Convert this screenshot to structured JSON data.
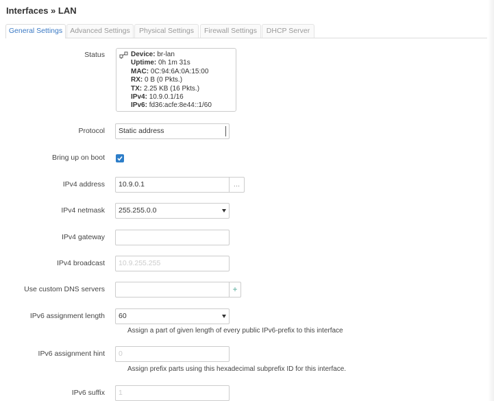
{
  "page": {
    "title": "Interfaces » LAN"
  },
  "tabs": [
    {
      "label": "General Settings",
      "active": true
    },
    {
      "label": "Advanced Settings",
      "active": false
    },
    {
      "label": "Physical Settings",
      "active": false
    },
    {
      "label": "Firewall Settings",
      "active": false
    },
    {
      "label": "DHCP Server",
      "active": false
    }
  ],
  "status": {
    "label": "Status",
    "icon": "network-bridge-icon",
    "device_key": "Device:",
    "device_val": "br-lan",
    "uptime_key": "Uptime:",
    "uptime_val": "0h 1m 31s",
    "mac_key": "MAC:",
    "mac_val": "0C:94:6A:0A:15:00",
    "rx_key": "RX:",
    "rx_val": "0 B (0 Pkts.)",
    "tx_key": "TX:",
    "tx_val": "2.25 KB (16 Pkts.)",
    "ipv4_key": "IPv4:",
    "ipv4_val": "10.9.0.1/16",
    "ipv6_key": "IPv6:",
    "ipv6_val": "fd36:acfe:8e44::1/60"
  },
  "protocol": {
    "label": "Protocol",
    "value": "Static address"
  },
  "boot": {
    "label": "Bring up on boot",
    "checked": true
  },
  "ipv4_address": {
    "label": "IPv4 address",
    "value": "10.9.0.1",
    "addon": "..."
  },
  "ipv4_netmask": {
    "label": "IPv4 netmask",
    "value": "255.255.0.0"
  },
  "ipv4_gateway": {
    "label": "IPv4 gateway",
    "value": ""
  },
  "ipv4_broadcast": {
    "label": "IPv4 broadcast",
    "placeholder": "10.9.255.255"
  },
  "dns": {
    "label": "Use custom DNS servers",
    "value": "",
    "addon": "+"
  },
  "ipv6_len": {
    "label": "IPv6 assignment length",
    "value": "60",
    "help": "Assign a part of given length of every public IPv6-prefix to this interface"
  },
  "ipv6_hint": {
    "label": "IPv6 assignment hint",
    "placeholder": "0",
    "help": "Assign prefix parts using this hexadecimal subprefix ID for this interface."
  },
  "ipv6_suffix": {
    "label": "IPv6 suffix",
    "placeholder": "1"
  },
  "colors": {
    "accent": "#2d7ec9",
    "tab_active": "#3a79c4"
  }
}
